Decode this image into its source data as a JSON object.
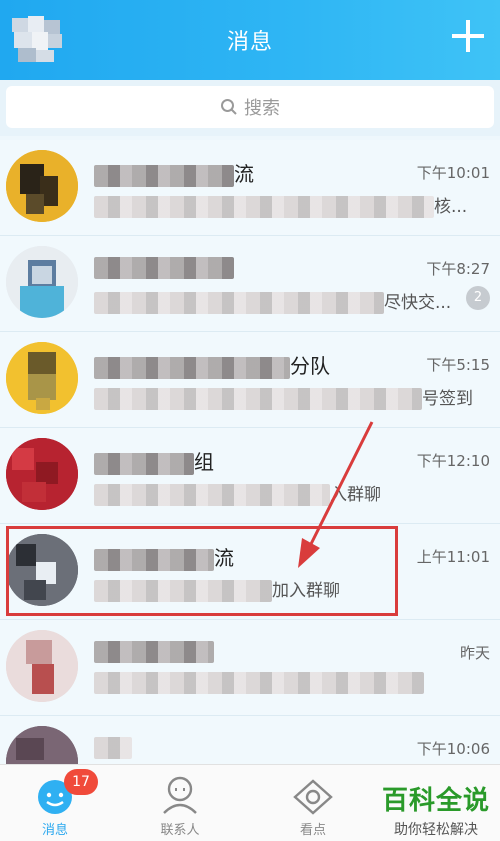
{
  "header": {
    "title": "消息"
  },
  "search": {
    "placeholder": "搜索"
  },
  "chats": [
    {
      "name_suffix": "流",
      "msg_suffix": "核...",
      "time": "下午10:01"
    },
    {
      "name_suffix": "",
      "msg_suffix": "尽快交...",
      "time": "下午8:27",
      "unread": "2"
    },
    {
      "name_suffix": "分队",
      "msg_suffix": "号签到",
      "time": "下午5:15"
    },
    {
      "name_suffix": "组",
      "msg_suffix": "入群聊",
      "time": "下午12:10"
    },
    {
      "name_suffix": "流",
      "msg_suffix": "加入群聊",
      "time": "上午11:01"
    },
    {
      "name_suffix": "",
      "msg_suffix": "",
      "time": "昨天"
    },
    {
      "name_suffix": "",
      "msg_suffix": "",
      "time": "下午10:06"
    }
  ],
  "tabs": [
    {
      "label": "消息",
      "count": "17"
    },
    {
      "label": "联系人"
    },
    {
      "label": "看点"
    }
  ],
  "watermark": {
    "title": "百科全说",
    "subtitle": "助你轻松解决"
  },
  "colors": {
    "header": "#2fb6f4",
    "accent": "#2aa8ef",
    "badge": "#f04a3a",
    "highlight": "#d93c3c"
  }
}
